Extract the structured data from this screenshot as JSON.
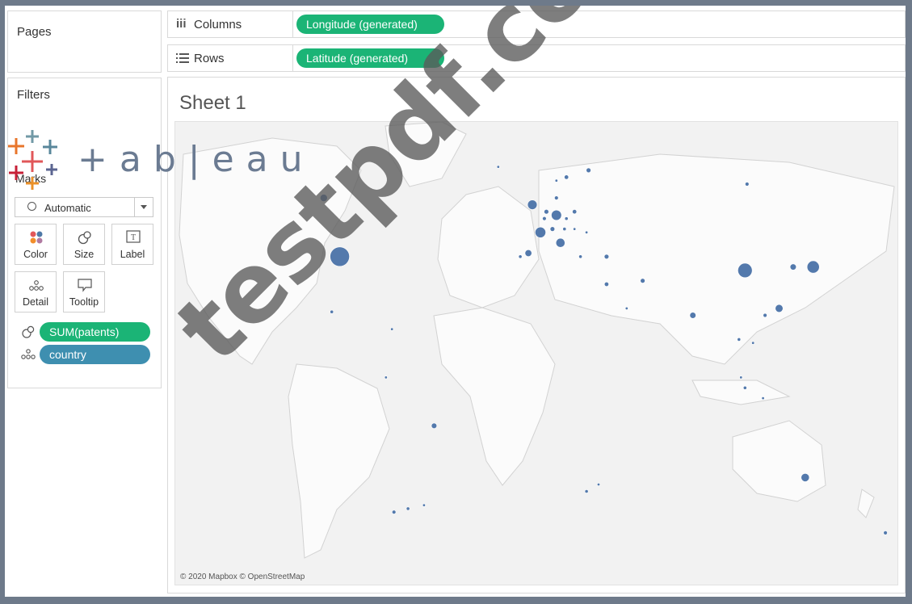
{
  "pages": {
    "title": "Pages"
  },
  "filters": {
    "title": "Filters"
  },
  "marks": {
    "title": "Marks",
    "type_select": "Automatic",
    "cards": {
      "color": "Color",
      "size": "Size",
      "label": "Label",
      "detail": "Detail",
      "tooltip": "Tooltip"
    },
    "fields": {
      "size_field": "SUM(patents)",
      "detail_field": "country"
    }
  },
  "columns": {
    "label": "Columns",
    "pill": "Longitude (generated)"
  },
  "rows": {
    "label": "Rows",
    "pill": "Latitude (generated)"
  },
  "sheet": {
    "title": "Sheet 1",
    "attribution": "© 2020 Mapbox © OpenStreetMap"
  },
  "logo": {
    "text": "+ab|eau"
  },
  "watermark": {
    "text": "testpdf.com"
  },
  "colors": {
    "green_pill": "#1bb476",
    "blue_pill": "#3e8fb0",
    "marks": "#4a72a8"
  },
  "chart_data": {
    "type": "scatter",
    "title": "Sheet 1",
    "xlabel": "Longitude (generated)",
    "ylabel": "Latitude (generated)",
    "xlim": [
      -180,
      180
    ],
    "ylim": [
      -56,
      78
    ],
    "points": [
      {
        "lon": -98,
        "lat": 39,
        "value": 100
      },
      {
        "lon": -106,
        "lat": 56,
        "value": 14
      },
      {
        "lon": -102,
        "lat": 23,
        "value": 3
      },
      {
        "lon": -72,
        "lat": 18,
        "value": 2
      },
      {
        "lon": -75,
        "lat": 4,
        "value": 2
      },
      {
        "lon": -51,
        "lat": -10,
        "value": 8
      },
      {
        "lon": -71,
        "lat": -35,
        "value": 4
      },
      {
        "lon": -64,
        "lat": -34,
        "value": 3
      },
      {
        "lon": -56,
        "lat": -33,
        "value": 2
      },
      {
        "lon": -19,
        "lat": 65,
        "value": 2
      },
      {
        "lon": 10,
        "lat": 51,
        "value": 28
      },
      {
        "lon": 2,
        "lat": 46,
        "value": 30
      },
      {
        "lon": -2,
        "lat": 54,
        "value": 24
      },
      {
        "lon": 5,
        "lat": 52,
        "value": 6
      },
      {
        "lon": 4,
        "lat": 50,
        "value": 4
      },
      {
        "lon": 8,
        "lat": 47,
        "value": 6
      },
      {
        "lon": 14,
        "lat": 47,
        "value": 3
      },
      {
        "lon": 12,
        "lat": 43,
        "value": 22
      },
      {
        "lon": -4,
        "lat": 40,
        "value": 12
      },
      {
        "lon": -8,
        "lat": 39,
        "value": 3
      },
      {
        "lon": 15,
        "lat": 62,
        "value": 5
      },
      {
        "lon": 26,
        "lat": 64,
        "value": 6
      },
      {
        "lon": 10,
        "lat": 61,
        "value": 2
      },
      {
        "lon": 10,
        "lat": 56,
        "value": 4
      },
      {
        "lon": 19,
        "lat": 52,
        "value": 5
      },
      {
        "lon": 15,
        "lat": 50,
        "value": 3
      },
      {
        "lon": 19,
        "lat": 47,
        "value": 2
      },
      {
        "lon": 25,
        "lat": 46,
        "value": 2
      },
      {
        "lon": 22,
        "lat": 39,
        "value": 3
      },
      {
        "lon": 105,
        "lat": 60,
        "value": 4
      },
      {
        "lon": 35,
        "lat": 39,
        "value": 6
      },
      {
        "lon": 35,
        "lat": 31,
        "value": 5
      },
      {
        "lon": 53,
        "lat": 32,
        "value": 6
      },
      {
        "lon": 45,
        "lat": 24,
        "value": 2
      },
      {
        "lon": 78,
        "lat": 22,
        "value": 10
      },
      {
        "lon": 104,
        "lat": 35,
        "value": 55
      },
      {
        "lon": 138,
        "lat": 36,
        "value": 40
      },
      {
        "lon": 128,
        "lat": 36,
        "value": 10
      },
      {
        "lon": 121,
        "lat": 24,
        "value": 16
      },
      {
        "lon": 114,
        "lat": 22,
        "value": 4
      },
      {
        "lon": 101,
        "lat": 15,
        "value": 3
      },
      {
        "lon": 108,
        "lat": 14,
        "value": 2
      },
      {
        "lon": 102,
        "lat": 4,
        "value": 2
      },
      {
        "lon": 104,
        "lat": 1,
        "value": 3
      },
      {
        "lon": 113,
        "lat": -2,
        "value": 2
      },
      {
        "lon": 25,
        "lat": -29,
        "value": 3
      },
      {
        "lon": 31,
        "lat": -27,
        "value": 2
      },
      {
        "lon": 134,
        "lat": -25,
        "value": 18
      },
      {
        "lon": 174,
        "lat": -41,
        "value": 4
      }
    ]
  }
}
